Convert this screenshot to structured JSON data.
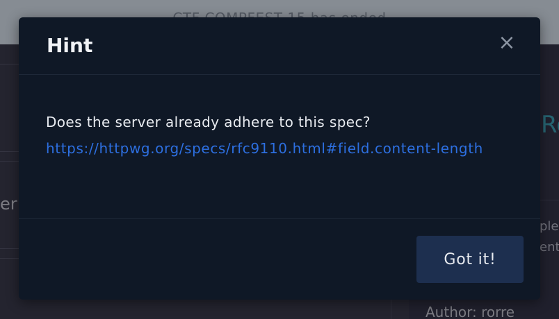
{
  "background": {
    "banner_text": "CTF COMPFEST 15 has ended",
    "left_partial_text": "er",
    "right_partial_heading": "Re",
    "right_partial_line1": "ple",
    "right_partial_line2": "ent",
    "author_label": "Author: rorre"
  },
  "modal": {
    "title": "Hint",
    "close_symbol": "×",
    "body_text": "Does the server already adhere to this spec?",
    "link_text": "https://httpwg.org/specs/rfc9110.html#field.content-length",
    "confirm_label": "Got it!"
  },
  "colors": {
    "modal_bg": "#0f1826",
    "link": "#2d6fe0",
    "button_bg": "#1d2f4f",
    "heading_accent": "#3fa3b8"
  }
}
